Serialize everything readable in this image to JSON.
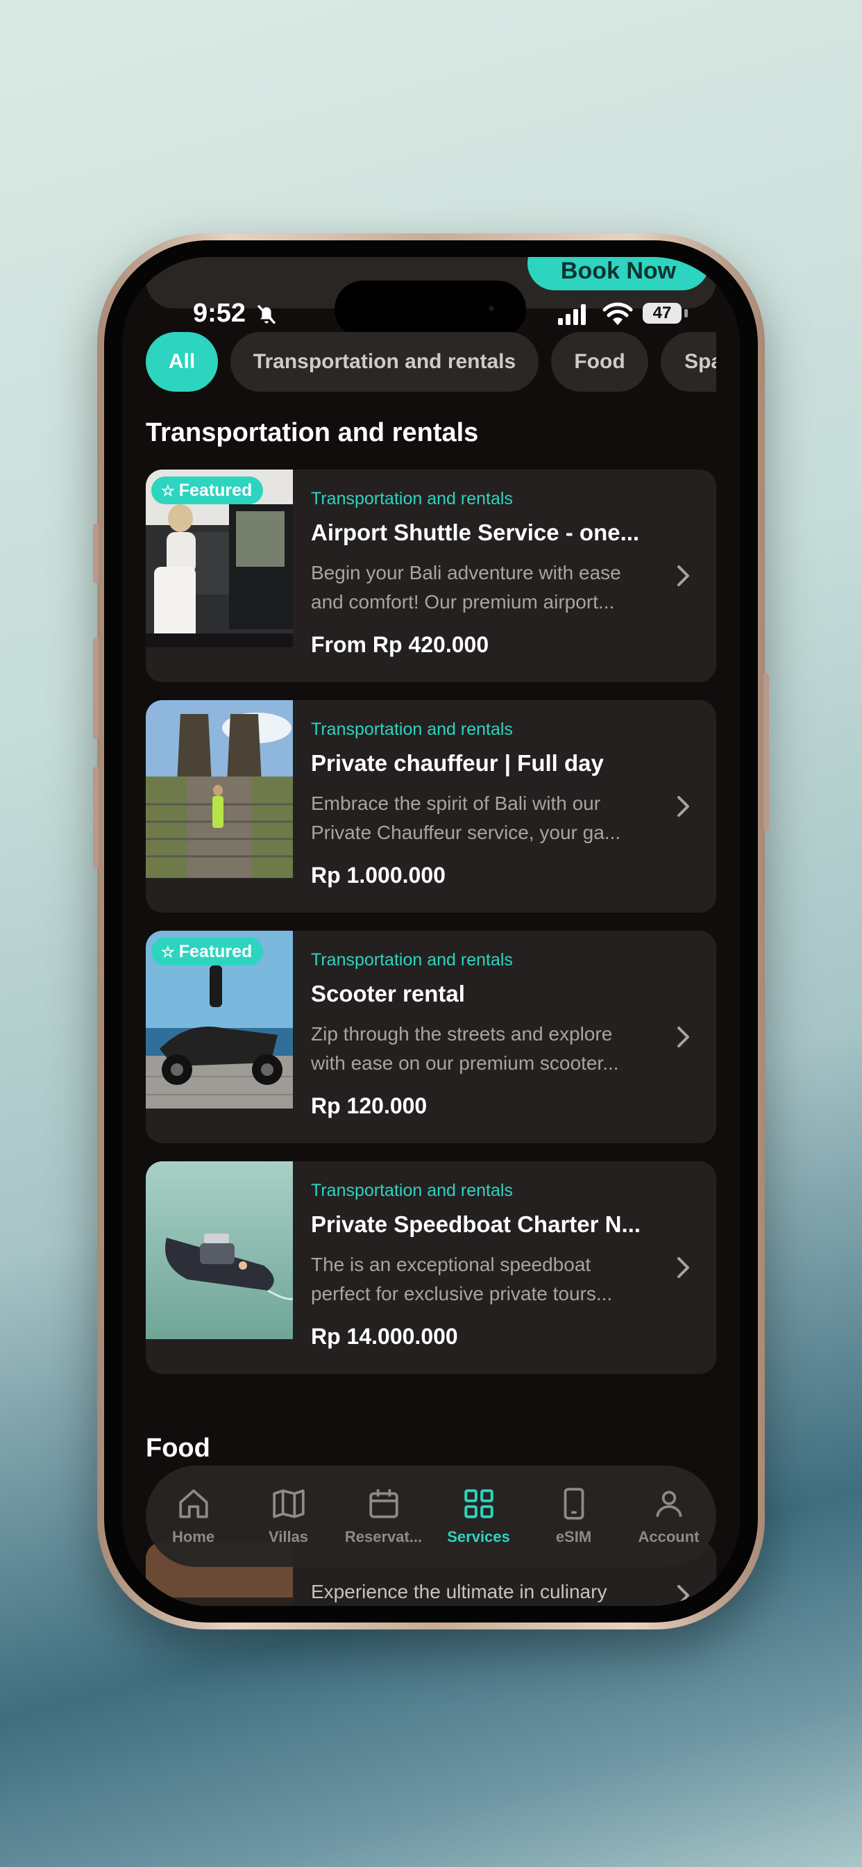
{
  "status_bar": {
    "time": "9:52",
    "battery": "47"
  },
  "header": {
    "book_button": "Book Now"
  },
  "filters": [
    {
      "label": "All",
      "active": true
    },
    {
      "label": "Transportation and rentals",
      "active": false
    },
    {
      "label": "Food",
      "active": false
    },
    {
      "label": "Spa",
      "active": false
    }
  ],
  "sections": {
    "transport_title": "Transportation and rentals",
    "food_title": "Food"
  },
  "featured_label": "Featured",
  "services": [
    {
      "category": "Transportation and rentals",
      "title": "Airport Shuttle Service - one...",
      "desc_line1": "Begin your Bali adventure with ease",
      "desc_line2": "and comfort! Our premium airport...",
      "price": "From Rp 420.000",
      "featured": true
    },
    {
      "category": "Transportation and rentals",
      "title": "Private chauffeur | Full day",
      "desc_line1": "Embrace the spirit of Bali with our",
      "desc_line2": "Private Chauffeur service, your ga...",
      "price": "Rp 1.000.000",
      "featured": false
    },
    {
      "category": "Transportation and rentals",
      "title": "Scooter rental",
      "desc_line1": "Zip through the streets and explore",
      "desc_line2": "with ease on our premium scooter...",
      "price": "Rp 120.000",
      "featured": true
    },
    {
      "category": "Transportation and rentals",
      "title": "Private Speedboat Charter N...",
      "desc_line1": "The is an exceptional speedboat",
      "desc_line2": "perfect for exclusive private tours...",
      "price": "Rp 14.000.000",
      "featured": false
    }
  ],
  "food_peek": {
    "desc_line1": "Experience the ultimate in culinary"
  },
  "nav": [
    {
      "label": "Home",
      "icon": "home-icon"
    },
    {
      "label": "Villas",
      "icon": "map-icon"
    },
    {
      "label": "Reservat...",
      "icon": "calendar-icon"
    },
    {
      "label": "Services",
      "icon": "grid-icon",
      "active": true
    },
    {
      "label": "eSIM",
      "icon": "phone-icon"
    },
    {
      "label": "Account",
      "icon": "user-icon"
    }
  ],
  "colors": {
    "accent": "#2dd4bf",
    "background": "#110d0c",
    "card": "#242020",
    "chip": "#2b2725"
  }
}
